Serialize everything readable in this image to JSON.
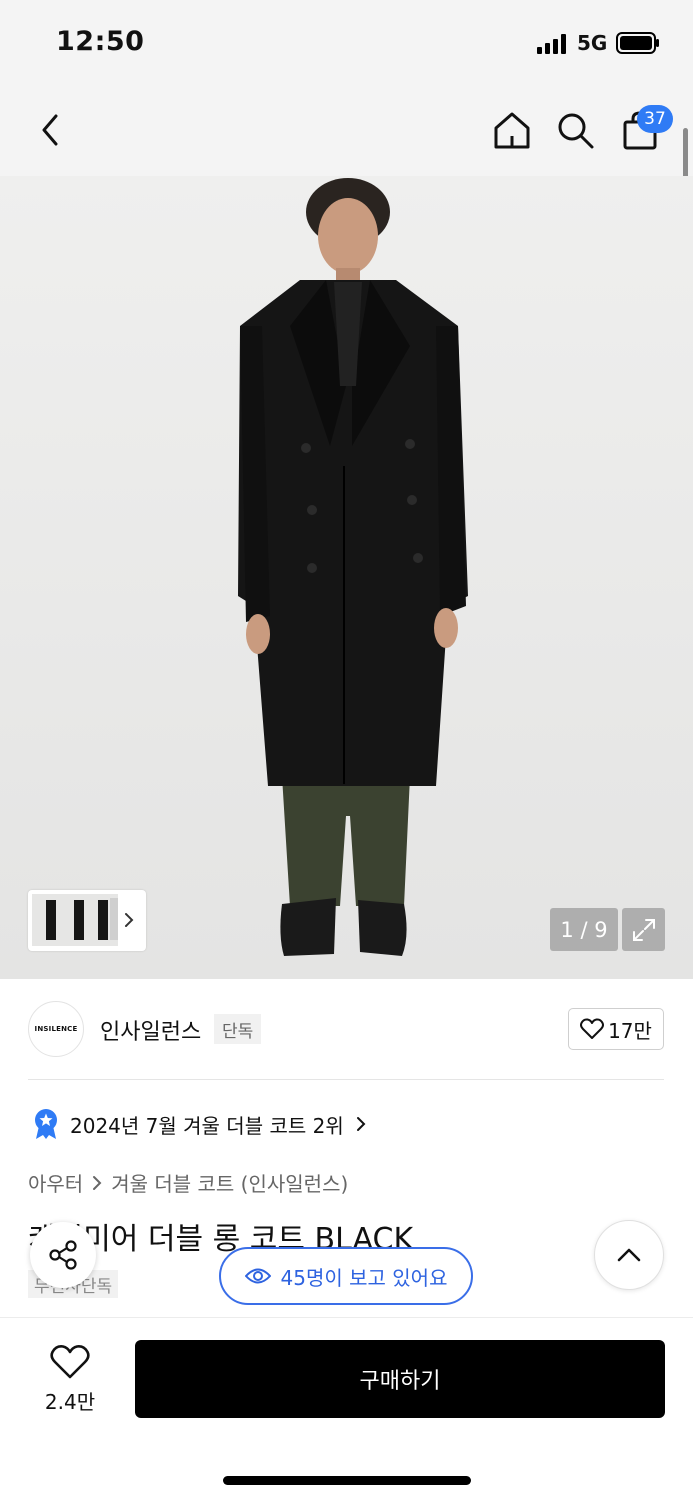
{
  "status_bar": {
    "time": "12:50",
    "network": "5G"
  },
  "nav": {
    "cart_count": "37"
  },
  "hero": {
    "image_counter": "1 / 9"
  },
  "brand": {
    "logo_text": "INSILENCE",
    "name": "인사일런스",
    "tag": "단독",
    "like_count": "17만"
  },
  "ranking": {
    "text": "2024년 7월 겨울 더블 코트 2위"
  },
  "breadcrumb": {
    "items": [
      "아우터",
      "겨울 더블 코트 (인사일런스)"
    ]
  },
  "product": {
    "title": "캐시미어 더블 롱 코트 BLACK",
    "subtag": "무신사단독"
  },
  "viewers": {
    "text": "45명이 보고 있어요"
  },
  "bottom": {
    "wish_count": "2.4만",
    "buy_label": "구매하기"
  },
  "colors": {
    "accent_blue": "#2f7bf5",
    "buy_button": "#000000"
  }
}
